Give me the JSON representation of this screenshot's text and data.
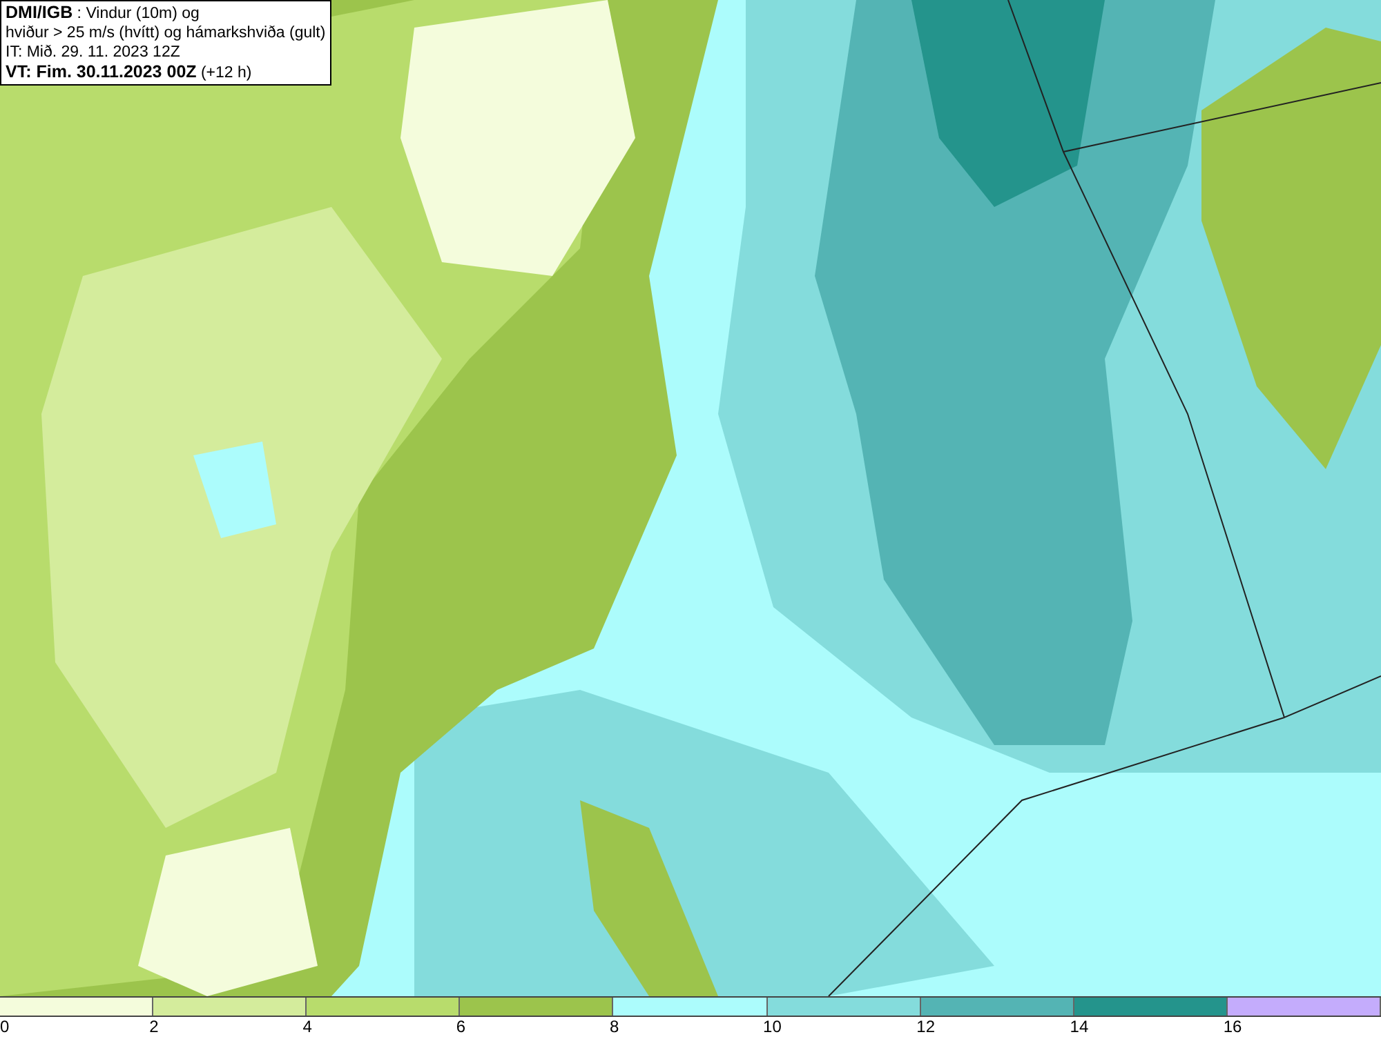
{
  "title_box": {
    "lines": [
      "**DMI/IGB** : Vindur (10m) og",
      "hviður > 25 m/s (hvítt) og hámarkshviða (gult)",
      "IT: Mið. 29. 11. 2023 12Z",
      "**VT: Fim. 30.11.2023 00Z** (+12 h)"
    ]
  },
  "legend": {
    "segments": [
      {
        "color": "#f4fcdc"
      },
      {
        "color": "#d4ec9c"
      },
      {
        "color": "#b8dc6c"
      },
      {
        "color": "#9cc44c"
      },
      {
        "color": "#acfcfc"
      },
      {
        "color": "#84dcdc"
      },
      {
        "color": "#54b4b4"
      },
      {
        "color": "#24948c"
      },
      {
        "color": "#c4acfc"
      }
    ],
    "ticks": [
      "0",
      "2",
      "4",
      "6",
      "8",
      "10",
      "12",
      "14",
      "16"
    ]
  }
}
